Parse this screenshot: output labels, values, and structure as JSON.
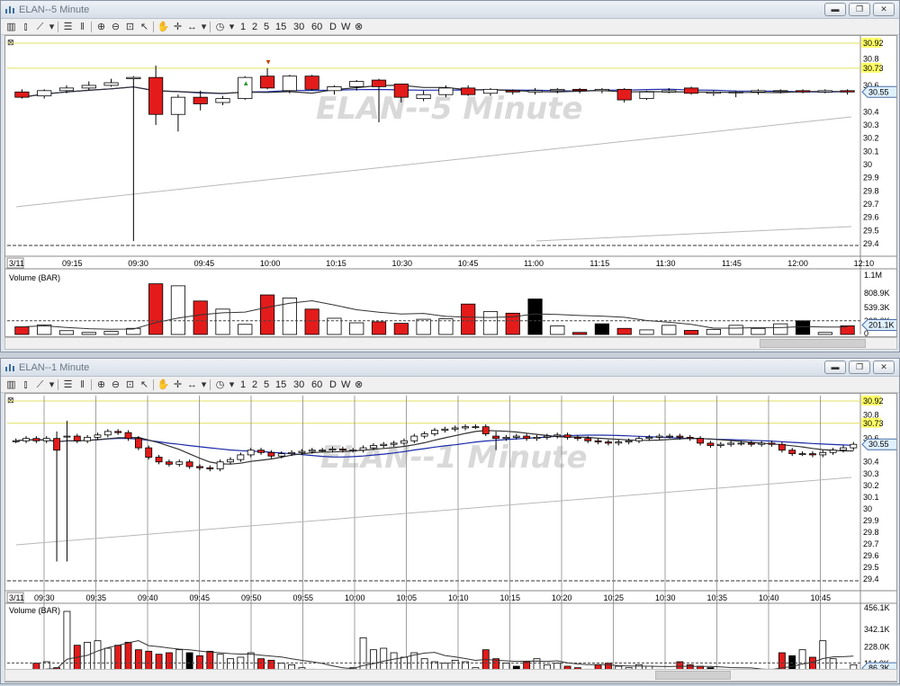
{
  "colors": {
    "up": "#ffffff",
    "down": "#e31b1b",
    "black": "#000000",
    "ma_blue": "#1a2aa8",
    "ma_dark": "#333333",
    "ma_gray": "#b8b8b8",
    "highlight": "#ffff66"
  },
  "toolbar": {
    "icons": [
      "bar-chart-icon",
      "candlestick-icon",
      "line-chart-icon",
      "dropdown-icon",
      "list-icon",
      "columns-icon",
      "zoom-in-icon",
      "zoom-out-icon",
      "zoom-fit-icon",
      "cursor-icon",
      "hand-icon",
      "crosshair-icon",
      "measure-icon",
      "dropdown-icon",
      "clock-icon",
      "dropdown-icon"
    ],
    "intervals": [
      "1",
      "2",
      "5",
      "15",
      "30",
      "60",
      "D",
      "W"
    ],
    "close_glyph": "⊗"
  },
  "windows": [
    {
      "title": "ELAN--5 Minute",
      "watermark": "ELAN--5 Minute",
      "price_labels": [
        "30.92",
        "30.8",
        "30.73",
        "30.6",
        "30.55",
        "30.4",
        "30.3",
        "30.2",
        "30.1",
        "30",
        "29.9",
        "29.8",
        "29.7",
        "29.6",
        "29.5",
        "29.4"
      ],
      "date_label": "3/11",
      "time_labels": [
        "09:15",
        "09:30",
        "09:45",
        "10:00",
        "10:15",
        "10:30",
        "10:45",
        "11:00",
        "11:15",
        "11:30",
        "11:45",
        "12:00",
        "12:10"
      ],
      "volume_title": "Volume (BAR)",
      "volume_labels": [
        "1.1M",
        "808.9K",
        "539.3K",
        "269.6K",
        "201.1K",
        "0"
      ],
      "last_price": "30.55",
      "last_volume": "201.1K"
    },
    {
      "title": "ELAN--1 Minute",
      "watermark": "ELAN--1 Minute",
      "price_labels": [
        "30.92",
        "30.8",
        "30.73",
        "30.6",
        "30.55",
        "30.4",
        "30.3",
        "30.2",
        "30.1",
        "30",
        "29.9",
        "29.8",
        "29.7",
        "29.6",
        "29.5",
        "29.4"
      ],
      "date_label": "3/11",
      "time_labels": [
        "09:30",
        "09:35",
        "09:40",
        "09:45",
        "09:50",
        "09:55",
        "10:00",
        "10:05",
        "10:10",
        "10:15",
        "10:20",
        "10:25",
        "10:30",
        "10:35",
        "10:40",
        "10:45"
      ],
      "volume_title": "Volume (BAR)",
      "volume_labels": [
        "456.1K",
        "342.1K",
        "228.0K",
        "114.0K",
        "86.3K",
        "0"
      ],
      "last_price": "30.55",
      "last_volume": "86.3K"
    }
  ],
  "chart_data": [
    {
      "type": "candlestick",
      "title": "ELAN--5 Minute",
      "x": [
        "09:10",
        "09:15",
        "09:20",
        "09:25",
        "09:30",
        "09:35",
        "09:40",
        "09:45",
        "09:50",
        "09:55",
        "10:00",
        "10:05",
        "10:10",
        "10:15",
        "10:20",
        "10:25",
        "10:30",
        "10:35",
        "10:40",
        "10:45",
        "10:50",
        "10:55",
        "11:00",
        "11:05",
        "11:10",
        "11:15",
        "11:20",
        "11:25",
        "11:30",
        "11:35",
        "11:40",
        "11:45",
        "11:50",
        "11:55",
        "12:00",
        "12:05",
        "12:10",
        "12:15"
      ],
      "ohlc": [
        [
          30.55,
          30.57,
          30.5,
          30.51
        ],
        [
          30.52,
          30.57,
          30.5,
          30.56
        ],
        [
          30.56,
          30.6,
          30.54,
          30.58
        ],
        [
          30.58,
          30.63,
          30.56,
          30.6
        ],
        [
          30.6,
          30.65,
          30.59,
          30.62
        ],
        [
          30.65,
          30.67,
          29.42,
          30.66
        ],
        [
          30.66,
          30.75,
          30.3,
          30.38
        ],
        [
          30.38,
          30.53,
          30.25,
          30.51
        ],
        [
          30.51,
          30.56,
          30.41,
          30.46
        ],
        [
          30.47,
          30.52,
          30.45,
          30.5
        ],
        [
          30.5,
          30.67,
          30.49,
          30.66
        ],
        [
          30.67,
          30.73,
          30.57,
          30.58
        ],
        [
          30.56,
          30.68,
          30.54,
          30.67
        ],
        [
          30.67,
          30.68,
          30.56,
          30.57
        ],
        [
          30.56,
          30.6,
          30.53,
          30.59
        ],
        [
          30.59,
          30.64,
          30.56,
          30.63
        ],
        [
          30.64,
          30.65,
          30.32,
          30.59
        ],
        [
          30.61,
          30.61,
          30.47,
          30.51
        ],
        [
          30.5,
          30.56,
          30.48,
          30.53
        ],
        [
          30.53,
          30.6,
          30.51,
          30.58
        ],
        [
          30.58,
          30.6,
          30.52,
          30.53
        ],
        [
          30.54,
          30.58,
          30.52,
          30.57
        ],
        [
          30.56,
          30.57,
          30.53,
          30.55
        ],
        [
          30.55,
          30.58,
          30.53,
          30.56
        ],
        [
          30.56,
          30.58,
          30.54,
          30.57
        ],
        [
          30.57,
          30.58,
          30.54,
          30.56
        ],
        [
          30.56,
          30.58,
          30.54,
          30.57
        ],
        [
          30.57,
          30.58,
          30.47,
          30.49
        ],
        [
          30.5,
          30.56,
          30.49,
          30.55
        ],
        [
          30.55,
          30.58,
          30.54,
          30.56
        ],
        [
          30.58,
          30.59,
          30.53,
          30.54
        ],
        [
          30.54,
          30.56,
          30.52,
          30.55
        ],
        [
          30.55,
          30.56,
          30.51,
          30.55
        ],
        [
          30.55,
          30.57,
          30.53,
          30.56
        ],
        [
          30.56,
          30.57,
          30.54,
          30.56
        ],
        [
          30.56,
          30.57,
          30.54,
          30.55
        ],
        [
          30.55,
          30.57,
          30.54,
          30.56
        ],
        [
          30.56,
          30.57,
          30.53,
          30.55
        ]
      ],
      "volume": [
        150000,
        190000,
        75000,
        40000,
        60000,
        120000,
        1000000,
        960000,
        660000,
        500000,
        200000,
        780000,
        720000,
        500000,
        320000,
        230000,
        250000,
        220000,
        300000,
        310000,
        600000,
        450000,
        420000,
        700000,
        170000,
        40000,
        210000,
        120000,
        90000,
        180000,
        80000,
        100000,
        180000,
        120000,
        210000,
        270000,
        40000,
        170000
      ],
      "ylim": [
        29.4,
        30.92
      ],
      "volume_ylim": [
        0,
        1100000
      ]
    },
    {
      "type": "candlestick",
      "title": "ELAN--1 Minute",
      "x_start": "09:27",
      "x_end": "10:49",
      "interval_minutes": 1,
      "close": [
        30.58,
        30.6,
        30.58,
        30.6,
        30.5,
        30.62,
        30.58,
        30.61,
        30.63,
        30.66,
        30.65,
        30.6,
        30.52,
        30.44,
        30.4,
        30.38,
        30.4,
        30.36,
        30.35,
        30.34,
        30.4,
        30.42,
        30.46,
        30.5,
        30.48,
        30.45,
        30.47,
        30.48,
        30.49,
        30.5,
        30.5,
        30.51,
        30.5,
        30.5,
        30.52,
        30.54,
        30.55,
        30.56,
        30.58,
        30.62,
        30.64,
        30.67,
        30.68,
        30.69,
        30.7,
        30.7,
        30.64,
        30.6,
        30.61,
        30.62,
        30.6,
        30.61,
        30.62,
        30.63,
        30.61,
        30.6,
        30.58,
        30.57,
        30.56,
        30.57,
        30.58,
        30.6,
        30.61,
        30.62,
        30.62,
        30.61,
        30.6,
        30.56,
        30.54,
        30.55,
        30.56,
        30.56,
        30.55,
        30.56,
        30.55,
        30.5,
        30.47,
        30.47,
        30.46,
        30.48,
        30.5,
        30.52,
        30.55
      ],
      "volume": [
        30000,
        25000,
        110000,
        120000,
        80000,
        456100,
        230000,
        250000,
        260000,
        210000,
        230000,
        250000,
        200000,
        190000,
        170000,
        180000,
        200000,
        180000,
        160000,
        190000,
        170000,
        140000,
        150000,
        180000,
        140000,
        130000,
        110000,
        100000,
        80000,
        70000,
        60000,
        50000,
        40000,
        80000,
        280000,
        200000,
        210000,
        180000,
        150000,
        180000,
        140000,
        120000,
        110000,
        130000,
        120000,
        80000,
        200000,
        140000,
        110000,
        90000,
        120000,
        140000,
        100000,
        110000,
        90000,
        80000,
        70000,
        100000,
        110000,
        90000,
        80000,
        100000,
        90000,
        70000,
        60000,
        120000,
        100000,
        90000,
        80000,
        70000,
        60000,
        60000,
        50000,
        60000,
        70000,
        180000,
        160000,
        200000,
        150000,
        260000,
        140000,
        70000,
        100000
      ],
      "ylim": [
        29.4,
        30.92
      ],
      "volume_ylim": [
        0,
        456100
      ]
    }
  ]
}
